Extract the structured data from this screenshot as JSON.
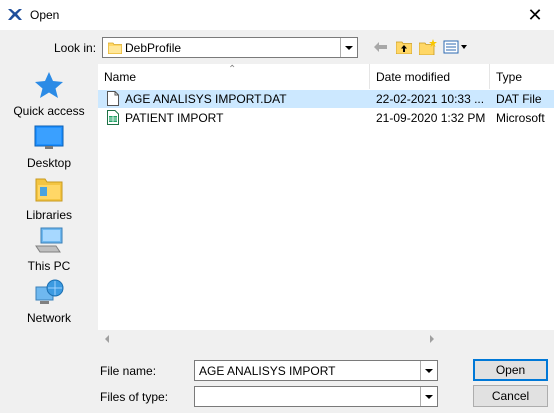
{
  "window": {
    "title": "Open",
    "close_glyph": "✕"
  },
  "look_in": {
    "label": "Look in:",
    "value": "DebProfile"
  },
  "toolbar": {
    "icons": [
      "back-arrow-icon",
      "up-folder-icon",
      "new-folder-icon",
      "view-menu-icon"
    ]
  },
  "places": [
    {
      "label": "Quick access",
      "icon": "star-icon"
    },
    {
      "label": "Desktop",
      "icon": "desktop-icon"
    },
    {
      "label": "Libraries",
      "icon": "libraries-icon"
    },
    {
      "label": "This PC",
      "icon": "computer-icon"
    },
    {
      "label": "Network",
      "icon": "network-icon"
    }
  ],
  "columns": {
    "name": "Name",
    "date": "Date modified",
    "type": "Type"
  },
  "files": [
    {
      "name": "AGE ANALISYS IMPORT.DAT",
      "date": "22-02-2021 10:33 ...",
      "type": "DAT File",
      "icon": "document-icon",
      "selected": true
    },
    {
      "name": "PATIENT IMPORT",
      "date": "21-09-2020 1:32 PM",
      "type": "Microsoft",
      "icon": "spreadsheet-icon",
      "selected": false
    }
  ],
  "file_name": {
    "label": "File name:",
    "value": "AGE ANALISYS IMPORT"
  },
  "files_of_type": {
    "label": "Files of type:",
    "value": ""
  },
  "buttons": {
    "open": "Open",
    "cancel": "Cancel"
  },
  "colors": {
    "selection": "#cce8ff",
    "accent": "#0078d7",
    "folder": "#ffd766",
    "star": "#2b8be6"
  }
}
